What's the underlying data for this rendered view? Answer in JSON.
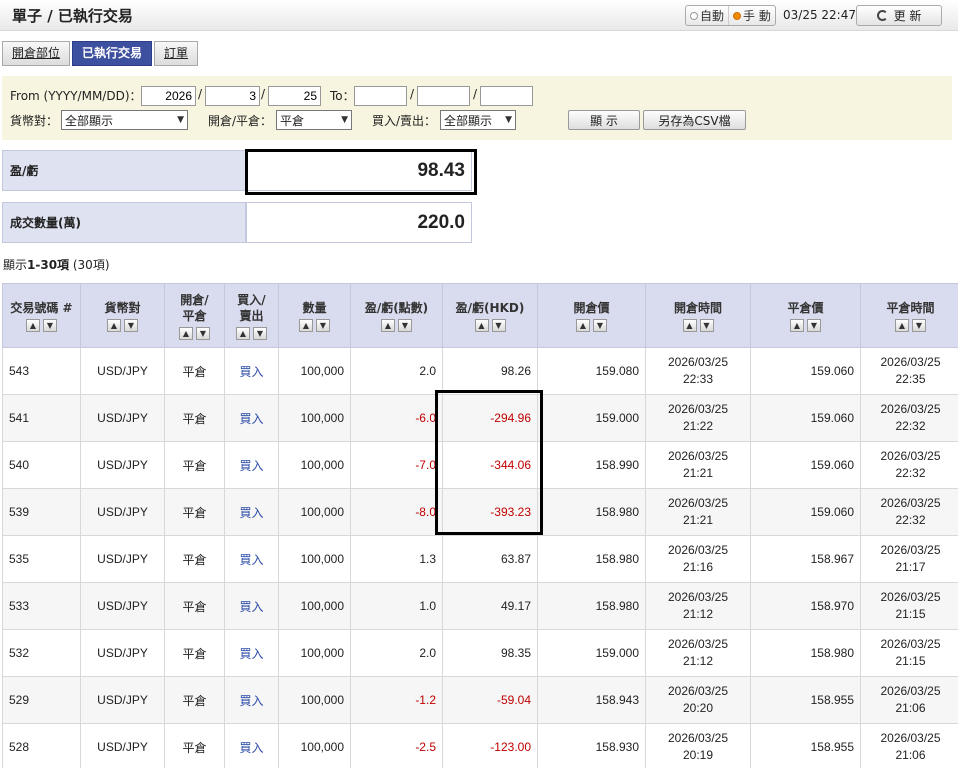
{
  "header": {
    "title": "單子 / 已執行交易",
    "mode_auto": "自動",
    "mode_manual": "手 動",
    "clock": "03/25 22:47",
    "refresh_label": "更 新"
  },
  "tabs": [
    {
      "label": "開倉部位",
      "active": false
    },
    {
      "label": "已執行交易",
      "active": true
    },
    {
      "label": "訂單",
      "active": false
    }
  ],
  "filter": {
    "from_label": "From (YYYY/MM/DD)：",
    "from_year": "2026",
    "from_month": "3",
    "from_day": "25",
    "to_label": "To：",
    "to_year": "",
    "to_month": "",
    "to_day": "",
    "sep": "/",
    "currency_label": "貨幣對：",
    "currency_value": "全部顯示",
    "openclose_label": "開倉/平倉：",
    "openclose_value": "平倉",
    "buysell_label": "買入/賣出：",
    "buysell_value": "全部顯示",
    "show_button": "顯 示",
    "csv_button": "另存為CSV檔"
  },
  "summary": {
    "pnl_label": "盈/虧",
    "pnl_value": "98.43",
    "volume_label": "成交數量(萬)",
    "volume_value": "220.0"
  },
  "count": {
    "prefix": "顯示",
    "range": "1-30項",
    "total": " (30項)"
  },
  "table": {
    "headers": [
      "交易號碼 #",
      "貨幣對",
      "開倉/\n平倉",
      "買入/\n賣出",
      "數量",
      "盈/虧(點數)",
      "盈/虧(HKD)",
      "開倉價",
      "開倉時間",
      "平倉價",
      "平倉時間"
    ],
    "sort_up": "▲",
    "sort_down": "▼",
    "rows": [
      {
        "id": "543",
        "pair": "USD/JPY",
        "oc": "平倉",
        "bs": "買入",
        "qty": "100,000",
        "pips": "2.0",
        "hkd": "98.26",
        "open_price": "159.080",
        "open_date": "2026/03/25",
        "open_time": "22:33",
        "close_price": "159.060",
        "close_date": "2026/03/25",
        "close_time": "22:35",
        "neg": false
      },
      {
        "id": "541",
        "pair": "USD/JPY",
        "oc": "平倉",
        "bs": "買入",
        "qty": "100,000",
        "pips": "-6.0",
        "hkd": "-294.96",
        "open_price": "159.000",
        "open_date": "2026/03/25",
        "open_time": "21:22",
        "close_price": "159.060",
        "close_date": "2026/03/25",
        "close_time": "22:32",
        "neg": true
      },
      {
        "id": "540",
        "pair": "USD/JPY",
        "oc": "平倉",
        "bs": "買入",
        "qty": "100,000",
        "pips": "-7.0",
        "hkd": "-344.06",
        "open_price": "158.990",
        "open_date": "2026/03/25",
        "open_time": "21:21",
        "close_price": "159.060",
        "close_date": "2026/03/25",
        "close_time": "22:32",
        "neg": true
      },
      {
        "id": "539",
        "pair": "USD/JPY",
        "oc": "平倉",
        "bs": "買入",
        "qty": "100,000",
        "pips": "-8.0",
        "hkd": "-393.23",
        "open_price": "158.980",
        "open_date": "2026/03/25",
        "open_time": "21:21",
        "close_price": "159.060",
        "close_date": "2026/03/25",
        "close_time": "22:32",
        "neg": true
      },
      {
        "id": "535",
        "pair": "USD/JPY",
        "oc": "平倉",
        "bs": "買入",
        "qty": "100,000",
        "pips": "1.3",
        "hkd": "63.87",
        "open_price": "158.980",
        "open_date": "2026/03/25",
        "open_time": "21:16",
        "close_price": "158.967",
        "close_date": "2026/03/25",
        "close_time": "21:17",
        "neg": false
      },
      {
        "id": "533",
        "pair": "USD/JPY",
        "oc": "平倉",
        "bs": "買入",
        "qty": "100,000",
        "pips": "1.0",
        "hkd": "49.17",
        "open_price": "158.980",
        "open_date": "2026/03/25",
        "open_time": "21:12",
        "close_price": "158.970",
        "close_date": "2026/03/25",
        "close_time": "21:15",
        "neg": false
      },
      {
        "id": "532",
        "pair": "USD/JPY",
        "oc": "平倉",
        "bs": "買入",
        "qty": "100,000",
        "pips": "2.0",
        "hkd": "98.35",
        "open_price": "159.000",
        "open_date": "2026/03/25",
        "open_time": "21:12",
        "close_price": "158.980",
        "close_date": "2026/03/25",
        "close_time": "21:15",
        "neg": false
      },
      {
        "id": "529",
        "pair": "USD/JPY",
        "oc": "平倉",
        "bs": "買入",
        "qty": "100,000",
        "pips": "-1.2",
        "hkd": "-59.04",
        "open_price": "158.943",
        "open_date": "2026/03/25",
        "open_time": "20:20",
        "close_price": "158.955",
        "close_date": "2026/03/25",
        "close_time": "21:06",
        "neg": true
      },
      {
        "id": "528",
        "pair": "USD/JPY",
        "oc": "平倉",
        "bs": "買入",
        "qty": "100,000",
        "pips": "-2.5",
        "hkd": "-123.00",
        "open_price": "158.930",
        "open_date": "2026/03/25",
        "open_time": "20:19",
        "close_price": "158.955",
        "close_date": "2026/03/25",
        "close_time": "21:06",
        "neg": true
      }
    ]
  },
  "colors": {
    "tab_active": "#3d4f9f",
    "header_bg": "#d9dcee",
    "filter_bg": "#f7f4df",
    "negative": "#c00000",
    "link_blue": "#2a4aa8"
  }
}
